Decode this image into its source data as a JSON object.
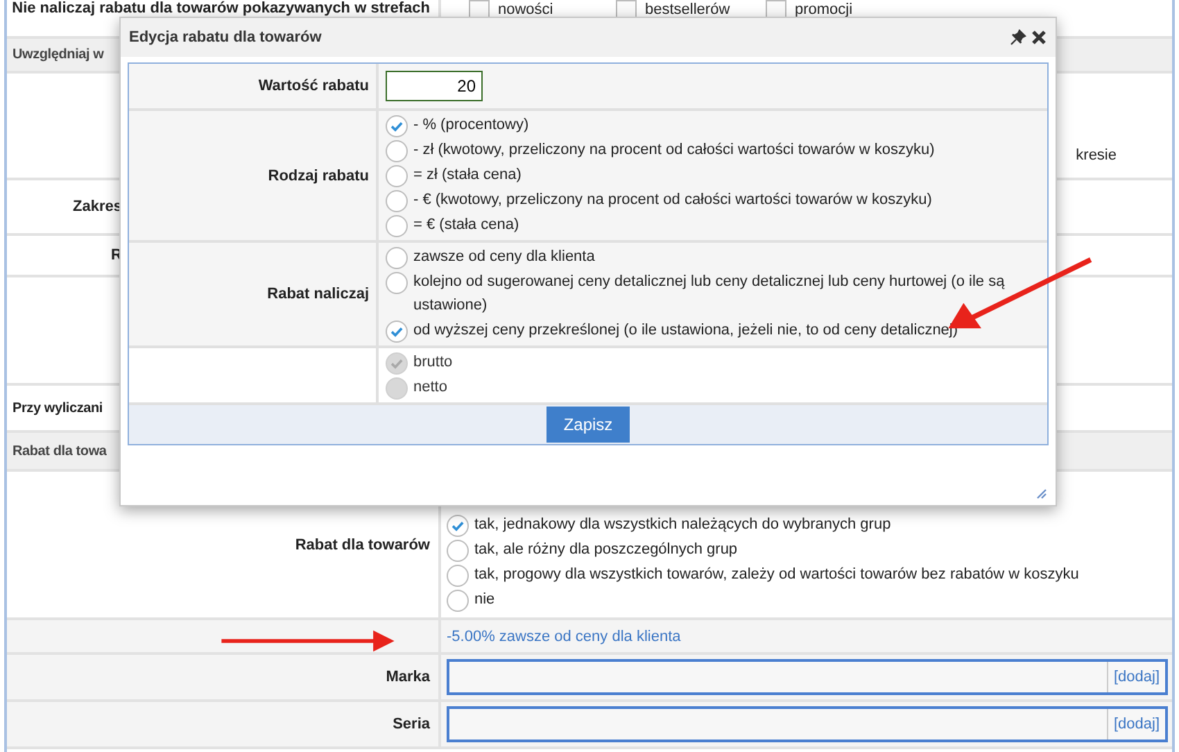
{
  "page": {
    "rows": [
      {
        "kind": "checks",
        "label": "Nie naliczaj rabatu dla towarów pokazywanych w strefach",
        "options": [
          {
            "label": "nowości",
            "checked": false
          },
          {
            "label": "bestsellerów",
            "checked": false
          },
          {
            "label": "promocji",
            "checked": false
          }
        ]
      },
      {
        "kind": "section",
        "label": "Uwzględniaj w"
      },
      {
        "kind": "note",
        "value": "kresie"
      },
      {
        "kind": "fragment",
        "label": "Zakres"
      },
      {
        "kind": "fragment",
        "label": "R"
      },
      {
        "kind": "blank"
      },
      {
        "kind": "lead",
        "label": "Przy wyliczani"
      },
      {
        "kind": "section",
        "label": "Rabat dla towa"
      },
      {
        "kind": "radios",
        "label": "Rabat dla towarów",
        "options": [
          {
            "label": "tak, jednakowy dla wszystkich należących do wybranych grup",
            "selected": true
          },
          {
            "label": "tak, ale różny dla poszczególnych grup",
            "selected": false
          },
          {
            "label": "tak, progowy dla wszystkich towarów, zależy od wartości towarów bez rabatów w koszyku",
            "selected": false
          },
          {
            "label": "nie",
            "selected": false
          }
        ]
      },
      {
        "kind": "link",
        "value": "-5.00% zawsze od ceny dla klienta"
      },
      {
        "kind": "field",
        "label": "Marka",
        "action": "[dodaj]"
      },
      {
        "kind": "field",
        "label": "Seria",
        "action": "[dodaj]"
      }
    ]
  },
  "dialog": {
    "title": "Edycja rabatu dla towarów",
    "rows": [
      {
        "kind": "input",
        "label": "Wartość rabatu",
        "value": "20"
      },
      {
        "kind": "radios",
        "label": "Rodzaj rabatu",
        "options": [
          {
            "label": "- % (procentowy)",
            "selected": true
          },
          {
            "label": "- zł (kwotowy, przeliczony na procent od całości wartości towarów w koszyku)",
            "selected": false
          },
          {
            "label": "= zł (stała cena)",
            "selected": false
          },
          {
            "label": "- € (kwotowy, przeliczony na procent od całości wartości towarów w koszyku)",
            "selected": false
          },
          {
            "label": "= € (stała cena)",
            "selected": false
          }
        ]
      },
      {
        "kind": "radios",
        "label": "Rabat naliczaj",
        "options": [
          {
            "label": "zawsze od ceny dla klienta",
            "selected": false
          },
          {
            "label": "kolejno od sugerowanej ceny detalicznej lub ceny detalicznej lub ceny hurtowej (o ile są ustawione)",
            "selected": false
          },
          {
            "label": "od wyższej ceny przekreślonej (o ile ustawiona, jeżeli nie, to od ceny detalicznej)",
            "selected": true
          }
        ]
      },
      {
        "kind": "radios",
        "disabled": true,
        "options": [
          {
            "label": "brutto",
            "selected": true
          },
          {
            "label": "netto",
            "selected": false
          }
        ]
      }
    ],
    "button": "Zapisz"
  }
}
